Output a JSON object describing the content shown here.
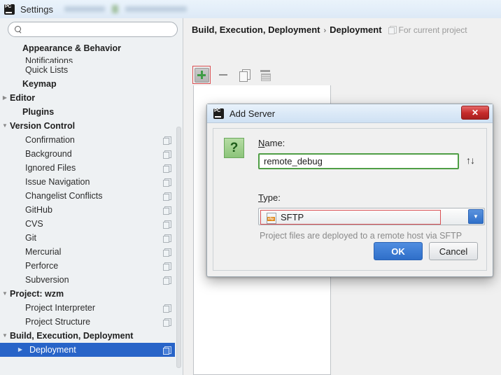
{
  "window": {
    "title": "Settings",
    "icon": "pycharm-icon"
  },
  "search": {
    "value": "",
    "placeholder": "",
    "icon": "search-icon"
  },
  "sidebar": {
    "items": [
      {
        "label": "Appearance & Behavior",
        "type": "category",
        "arrow": "",
        "copy": false,
        "selected": false,
        "clipped": false
      },
      {
        "label": "Notifications",
        "type": "child",
        "arrow": "",
        "copy": false,
        "selected": false,
        "clipped": true
      },
      {
        "label": "Quick Lists",
        "type": "child",
        "arrow": "",
        "copy": false,
        "selected": false,
        "clipped": false
      },
      {
        "label": "Keymap",
        "type": "category",
        "arrow": "",
        "copy": false,
        "selected": false,
        "clipped": false
      },
      {
        "label": "Editor",
        "type": "category",
        "arrow": "▶",
        "copy": false,
        "selected": false,
        "clipped": false
      },
      {
        "label": "Plugins",
        "type": "category",
        "arrow": "",
        "copy": false,
        "selected": false,
        "clipped": false
      },
      {
        "label": "Version Control",
        "type": "category",
        "arrow": "▼",
        "copy": false,
        "selected": false,
        "clipped": false
      },
      {
        "label": "Confirmation",
        "type": "child",
        "arrow": "",
        "copy": true,
        "selected": false,
        "clipped": false
      },
      {
        "label": "Background",
        "type": "child",
        "arrow": "",
        "copy": true,
        "selected": false,
        "clipped": false
      },
      {
        "label": "Ignored Files",
        "type": "child",
        "arrow": "",
        "copy": true,
        "selected": false,
        "clipped": false
      },
      {
        "label": "Issue Navigation",
        "type": "child",
        "arrow": "",
        "copy": true,
        "selected": false,
        "clipped": false
      },
      {
        "label": "Changelist Conflicts",
        "type": "child",
        "arrow": "",
        "copy": true,
        "selected": false,
        "clipped": false
      },
      {
        "label": "GitHub",
        "type": "child",
        "arrow": "",
        "copy": true,
        "selected": false,
        "clipped": false
      },
      {
        "label": "CVS",
        "type": "child",
        "arrow": "",
        "copy": true,
        "selected": false,
        "clipped": false
      },
      {
        "label": "Git",
        "type": "child",
        "arrow": "",
        "copy": true,
        "selected": false,
        "clipped": false
      },
      {
        "label": "Mercurial",
        "type": "child",
        "arrow": "",
        "copy": true,
        "selected": false,
        "clipped": false
      },
      {
        "label": "Perforce",
        "type": "child",
        "arrow": "",
        "copy": true,
        "selected": false,
        "clipped": false
      },
      {
        "label": "Subversion",
        "type": "child",
        "arrow": "",
        "copy": true,
        "selected": false,
        "clipped": false
      },
      {
        "label": "Project: wzm",
        "type": "category",
        "arrow": "▼",
        "copy": false,
        "selected": false,
        "clipped": false
      },
      {
        "label": "Project Interpreter",
        "type": "child",
        "arrow": "",
        "copy": true,
        "selected": false,
        "clipped": false
      },
      {
        "label": "Project Structure",
        "type": "child",
        "arrow": "",
        "copy": true,
        "selected": false,
        "clipped": false
      },
      {
        "label": "Build, Execution, Deployment",
        "type": "category",
        "arrow": "▼",
        "copy": false,
        "selected": false,
        "clipped": false
      },
      {
        "label": "Deployment",
        "type": "child-arrow",
        "arrow": "▶",
        "copy": true,
        "selected": true,
        "clipped": false
      }
    ]
  },
  "main": {
    "breadcrumb": {
      "part1": "Build, Execution, Deployment",
      "separator": "›",
      "part2": "Deployment",
      "note": "For current project",
      "note_icon": "copy-icon"
    },
    "toolbar": {
      "add_label": "+",
      "add_icon": "plus-icon",
      "remove_icon": "minus-icon",
      "copy_icon": "copy-icon",
      "paste_icon": "paste-icon"
    }
  },
  "dialog": {
    "title": "Add Server",
    "icon": "pycharm-icon",
    "close_label": "✕",
    "help_icon": "question-icon",
    "name_label_pre": "N",
    "name_label_post": "ame:",
    "name_value": "remote_debug",
    "updown_icon": "↑↓",
    "type_label_pre": "T",
    "type_label_post": "ype:",
    "type_value": "SFTP",
    "type_icon": "sftp-file-icon",
    "combo_arrow": "▼",
    "hint": "Project files are deployed to a remote host via SFTP",
    "ok_label": "OK",
    "cancel_label": "Cancel"
  },
  "colors": {
    "accent_blue": "#2f6fc9",
    "selection_blue": "#2864c8",
    "highlight_red": "#d94f52",
    "highlight_green": "#4f9e45",
    "plus_green": "#3f9c46"
  }
}
